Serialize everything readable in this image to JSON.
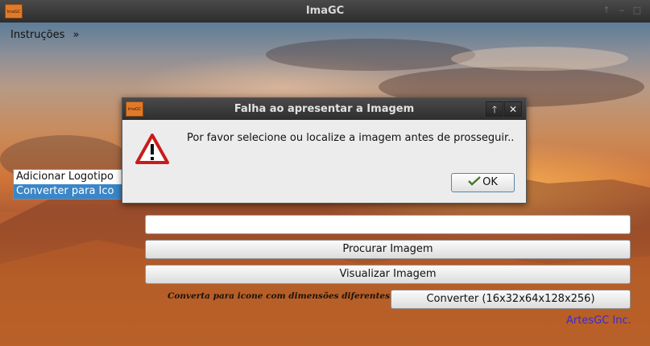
{
  "window": {
    "title": "ImaGC",
    "icon_text": "ImaGC"
  },
  "menu": {
    "label": "Instruções",
    "arrow": "»"
  },
  "options": [
    {
      "label": "Adicionar Logotipo",
      "selected": false
    },
    {
      "label": "Converter para Ico",
      "selected": true
    }
  ],
  "path_input": {
    "value": "",
    "placeholder": ""
  },
  "buttons": {
    "browse": "Procurar Imagem",
    "preview": "Visualizar Imagem",
    "convert": "Converter (16x32x64x128x256)"
  },
  "hint": "Converta para icone com dimensões diferentes:",
  "brand": "ArtesGC Inc.",
  "dialog": {
    "title": "Falha ao apresentar a Imagem",
    "icon_text": "ImaGC",
    "message": "Por favor selecione ou localize a imagem antes de prosseguir..",
    "ok_label": "OK",
    "maximize_glyph": "🡑",
    "close_glyph": "✕"
  },
  "colors": {
    "selection": "#3a86c8",
    "brand": "#3a2ad0",
    "titlebar": "#2e2e2e"
  }
}
